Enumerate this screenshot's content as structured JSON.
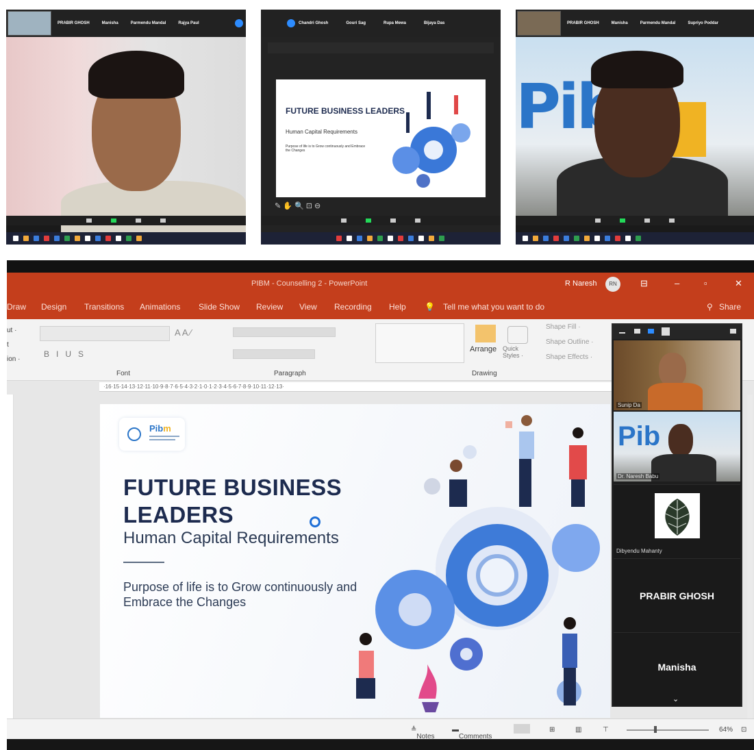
{
  "zoom_a": {
    "names": [
      "PRABIR GHOSH",
      "Manisha",
      "Parmendu Mandal",
      "Rajya Paul"
    ]
  },
  "zoom_b": {
    "names": [
      "Chandri Ghosh",
      "Gouri Sag",
      "Rupa Mewa",
      "Bijaya Das"
    ],
    "slide_title": "FUTURE BUSINESS LEADERS",
    "slide_subtitle": "Human Capital Requirements",
    "slide_para": "Purpose of life is to Grow continuously and Embrace the Changes"
  },
  "zoom_c": {
    "names": [
      "PRABIR GHOSH",
      "Manisha",
      "Parmendu Mandal",
      "Supriyo Poddar"
    ],
    "bg_text": "Pib"
  },
  "ppt": {
    "window_title": "PIBM - Counselling 2  -  PowerPoint",
    "user_name": "R Naresh",
    "user_initials": "RN",
    "tabs": [
      "Draw",
      "Design",
      "Transitions",
      "Animations",
      "Slide Show",
      "Review",
      "View",
      "Recording",
      "Help"
    ],
    "tell_me": "Tell me what you want to do",
    "share": "Share",
    "clipboard_items": [
      "ut ·",
      "t",
      "ion ·"
    ],
    "font_group": "Font",
    "paragraph_group": "Paragraph",
    "drawing_group": "Drawing",
    "arrange": "Arrange",
    "quick_styles": "Quick Styles ·",
    "shape_fill": "Shape Fill ·",
    "shape_outline": "Shape Outline ·",
    "shape_effects": "Shape Effects ·",
    "ruler_text": "·16·15·14·13·12·11·10·9·8·7·6·5·4·3·2·1·0·1·2·3·4·5·6·7·8·9·10·11·12·13·",
    "slide": {
      "logo_word_a": "Pib",
      "logo_word_b": "m",
      "title_line1": "FUTURE BUSINESS",
      "title_line2": "LEADERS",
      "subtitle": "Human Capital Requirements",
      "para": "Purpose of life is to Grow continuously and Embrace the Changes"
    },
    "gallery": {
      "participants": [
        {
          "name": "Sunip Da"
        },
        {
          "name": "Dr. Naresh Babu"
        },
        {
          "name": "Dibyendu Mahanty"
        },
        {
          "name": "PRABIR GHOSH"
        },
        {
          "name": "Manisha"
        }
      ]
    },
    "status": {
      "notes": "Notes",
      "comments": "Comments",
      "zoom": "64%"
    }
  }
}
